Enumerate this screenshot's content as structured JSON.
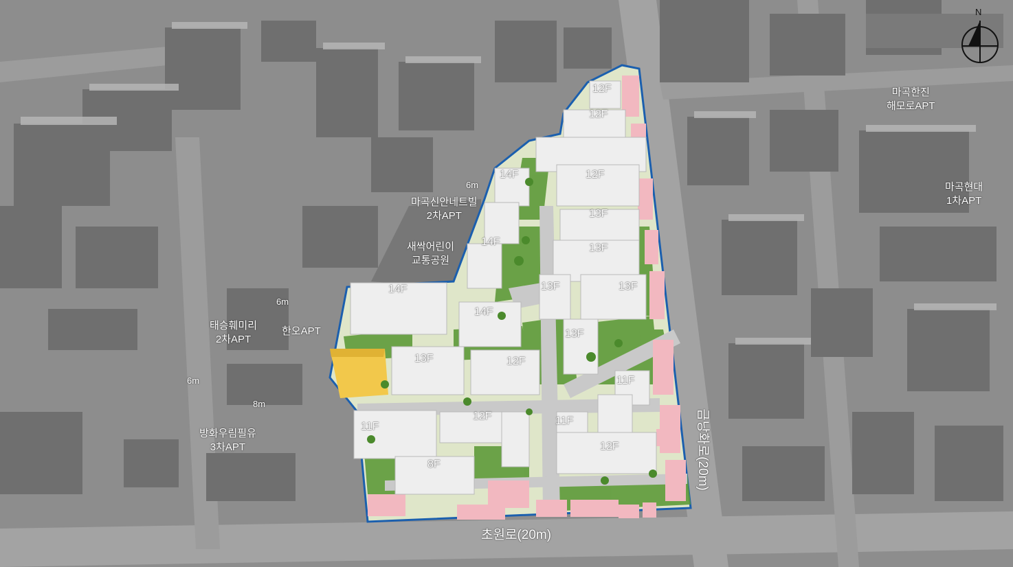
{
  "compass": {
    "label": "N"
  },
  "roads": {
    "south": "초원로(20m)",
    "east": "금낭화로(20m)",
    "width_6m": "6m",
    "width_8m": "8m"
  },
  "neighbors": {
    "hanjin": [
      "마곡한진",
      "해모로APT"
    ],
    "hyundai": [
      "마곡현대",
      "1차APT"
    ],
    "sinan": [
      "마곡신안네트빌",
      "2차APT"
    ],
    "park": [
      "새싹어린이",
      "교통공원"
    ],
    "taeseung": [
      "태승훼미리",
      "2차APT"
    ],
    "hanoh": [
      "한오APT"
    ],
    "banghwa": [
      "방화우림필유",
      "3차APT"
    ]
  },
  "floors": {
    "f1": "12F",
    "f2": "12F",
    "f3": "14F",
    "f4": "12F",
    "f5": "13F",
    "f6": "14F",
    "f7": "13F",
    "f8": "13F",
    "f9": "13F",
    "f10": "14F",
    "f11": "14F",
    "f12": "13F",
    "f13": "13F",
    "f14": "12F",
    "f15": "11F",
    "f16": "12F",
    "f17": "11F",
    "f18": "11F",
    "f19": "12F",
    "f20": "8F"
  },
  "colors": {
    "site_boundary": "#1b5fae",
    "commercial": "#f2b8c0",
    "landmark_building": "#f2c84b",
    "greenery": "#5e9a3a",
    "background_city": "#8f8f8f"
  }
}
